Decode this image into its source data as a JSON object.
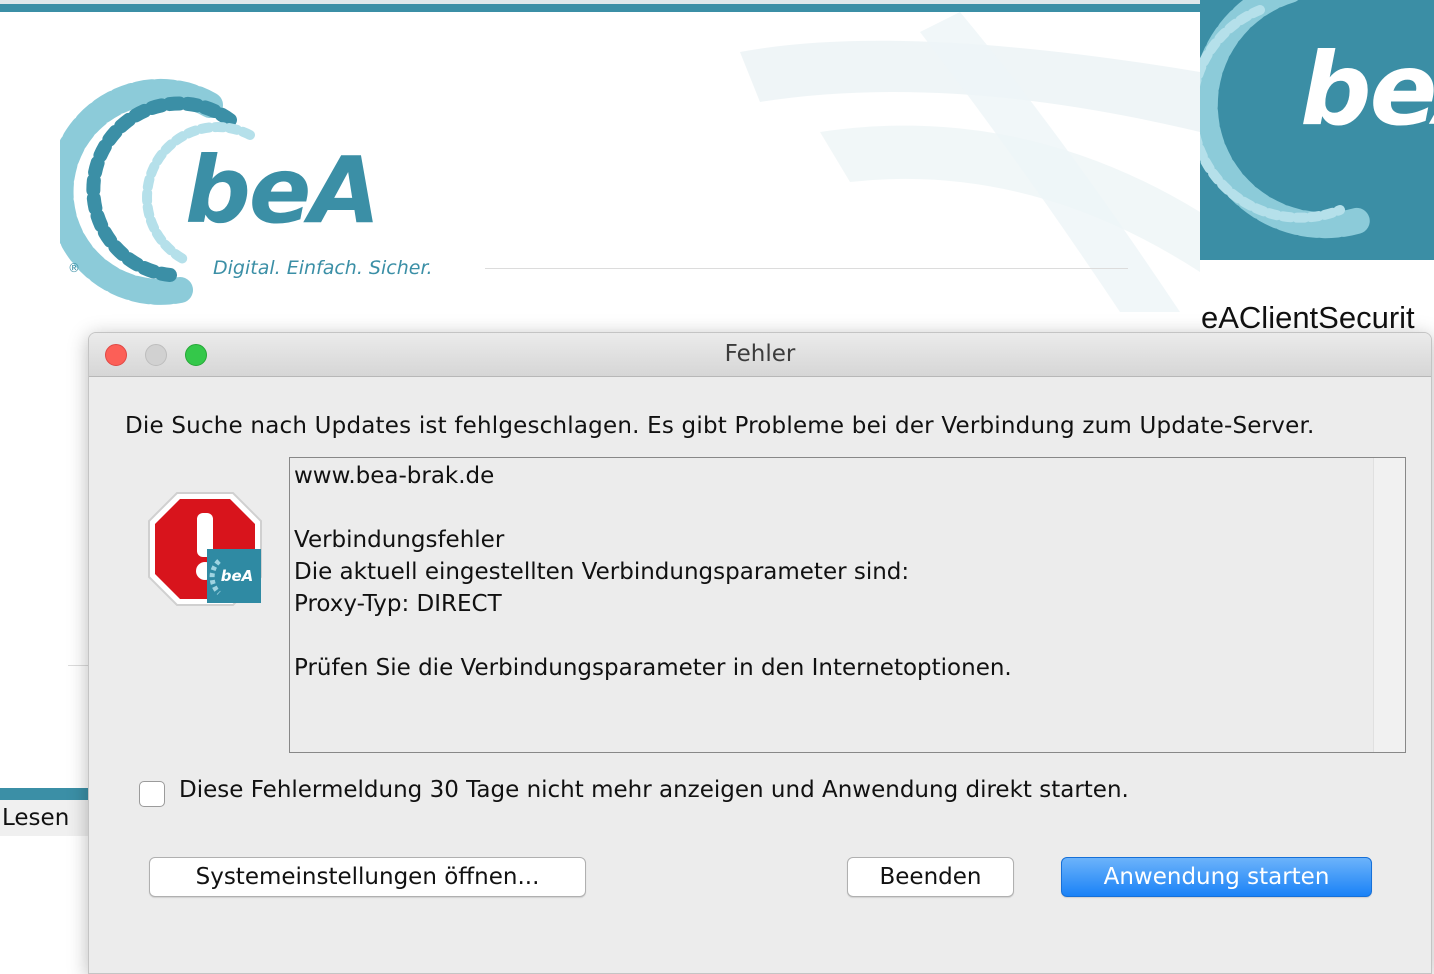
{
  "background": {
    "logo": {
      "wordmark": "beA",
      "tagline": "Digital. Einfach. Sicher.",
      "registered": "®"
    },
    "lesen_label": "Lesen",
    "right_panel": {
      "banner_text": "beA",
      "title": "eAClientSecurit"
    }
  },
  "dialog": {
    "title": "Fehler",
    "message": "Die Suche nach Updates ist fehlgeschlagen. Es gibt Probleme bei der Verbindung zum Update-Server.",
    "details_lines": [
      "www.bea-brak.de",
      "",
      "Verbindungsfehler",
      "Die aktuell eingestellten Verbindungsparameter sind:",
      "Proxy-Typ: DIRECT",
      "",
      "Prüfen Sie die Verbindungsparameter in den Internetoptionen."
    ],
    "icon_badge": "beA",
    "checkbox_label": "Diese Fehlermeldung 30 Tage nicht mehr anzeigen und Anwendung direkt starten.",
    "checkbox_checked": false,
    "buttons": {
      "settings": "Systemeinstellungen öffnen...",
      "quit": "Beenden",
      "start": "Anwendung starten"
    }
  },
  "colors": {
    "brand": "#3b8fa6",
    "primary_button": "#1a82f7",
    "error_red": "#d8141c"
  }
}
